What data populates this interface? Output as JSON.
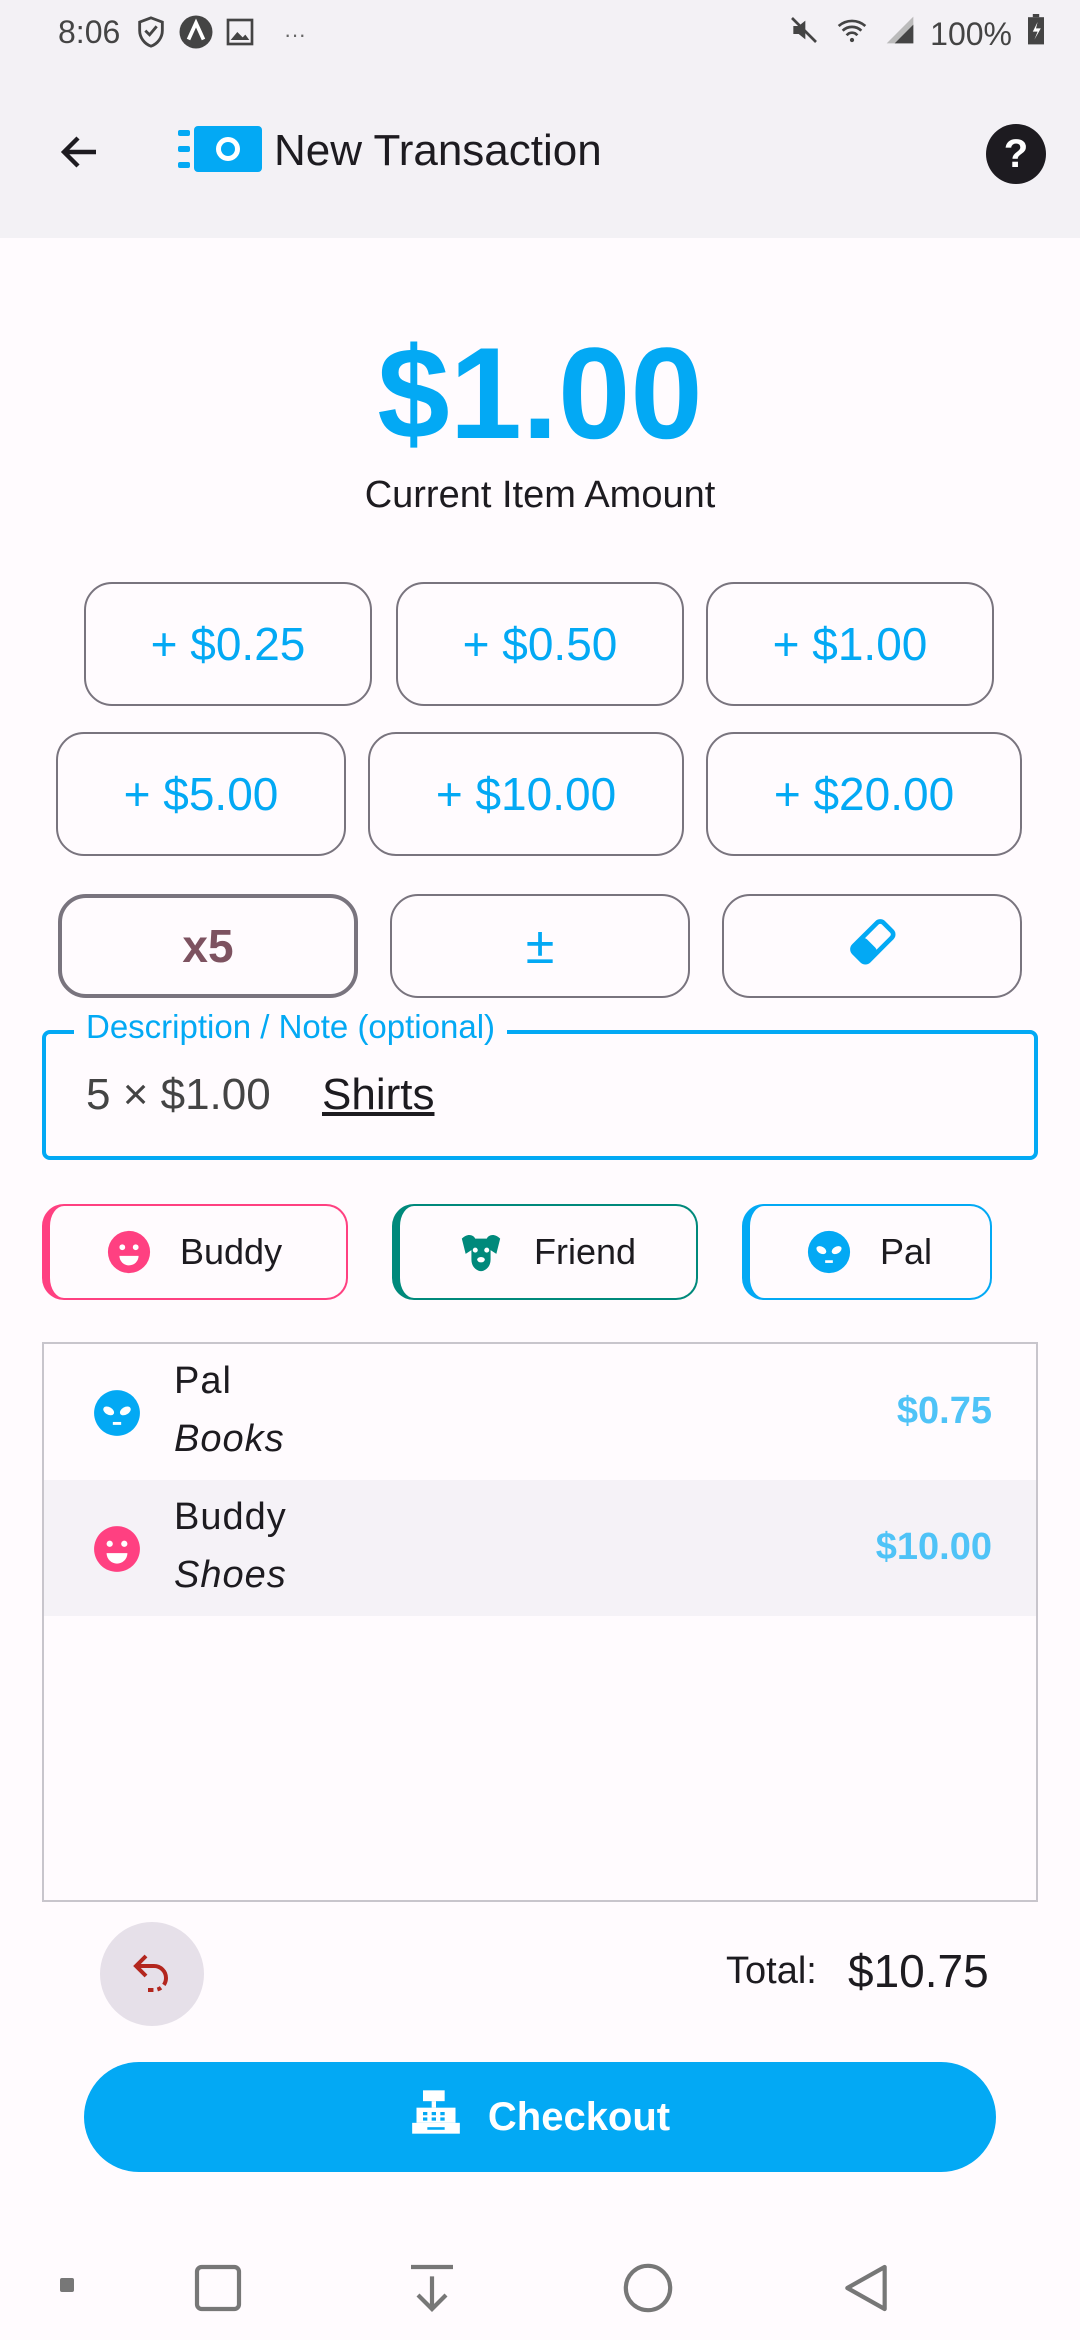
{
  "status": {
    "time": "8:06",
    "ellipsis": "···",
    "battery": "100%"
  },
  "header": {
    "title": "New Transaction"
  },
  "amount": {
    "value": "$1.00",
    "label": "Current Item Amount"
  },
  "quick_add": [
    "+ $0.25",
    "+ $0.50",
    "+ $1.00",
    "+ $5.00",
    "+ $10.00",
    "+ $20.00"
  ],
  "actions": {
    "multiplier": "x5",
    "plus_minus": "±"
  },
  "description": {
    "label": "Description / Note (optional)",
    "value": "5 × $1.00",
    "suggestion": "Shirts"
  },
  "people": [
    {
      "name": "Buddy",
      "icon": "smiley-face-icon",
      "color": "#ff4081"
    },
    {
      "name": "Friend",
      "icon": "dog-face-icon",
      "color": "#00897b"
    },
    {
      "name": "Pal",
      "icon": "alien-face-icon",
      "color": "#03a9f4"
    }
  ],
  "transactions": [
    {
      "person": "Pal",
      "note": "Books",
      "amount": "$0.75",
      "icon": "alien-face-icon"
    },
    {
      "person": "Buddy",
      "note": "Shoes",
      "amount": "$10.00",
      "icon": "smiley-face-icon"
    }
  ],
  "footer": {
    "total_label": "Total:",
    "total_value": "$10.75",
    "checkout_label": "Checkout"
  },
  "colors": {
    "accent": "#03a9f4",
    "pink": "#ff4081",
    "teal": "#00897b",
    "undo_red": "#b3261e"
  }
}
